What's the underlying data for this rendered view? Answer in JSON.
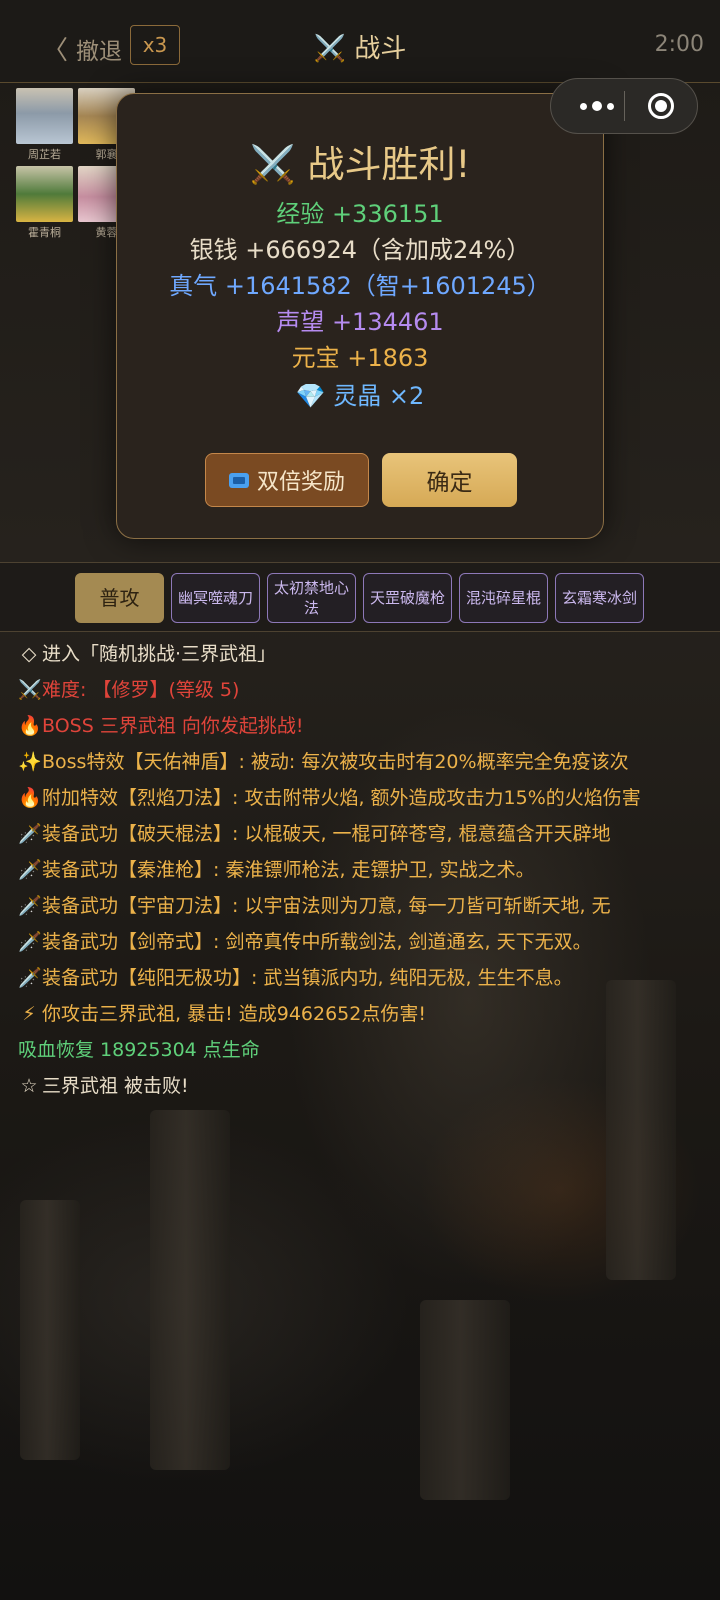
{
  "header": {
    "back_label": "撤退",
    "speed_label": "x3",
    "title_icon": "⚔️",
    "title": "战斗",
    "timer": "2:00"
  },
  "team": [
    {
      "name": "周芷若"
    },
    {
      "name": "郭襄"
    },
    {
      "name": "霍青桐"
    },
    {
      "name": "黄蓉"
    }
  ],
  "modal": {
    "title_icon": "⚔️",
    "title": "战斗胜利!",
    "rewards": [
      {
        "text": "经验 +336151",
        "color": "#5fd07a"
      },
      {
        "text": "银钱 +666924（含加成24%）",
        "color": "#e8ddc8"
      },
      {
        "text": "真气 +1641582（智+1601245）",
        "color": "#6fa8ff"
      },
      {
        "text": "声望 +134461",
        "color": "#b58bf0"
      },
      {
        "text": "元宝 +1863",
        "color": "#ecb24a"
      },
      {
        "text": "灵晶 ×2",
        "color": "#6fb8ff"
      }
    ],
    "gem_icon": "💎",
    "double_button": "双倍奖励",
    "confirm_button": "确定"
  },
  "skills": [
    {
      "label": "普攻"
    },
    {
      "label": "幽冥噬魂刀"
    },
    {
      "label": "太初禁地心法"
    },
    {
      "label": "天罡破魔枪"
    },
    {
      "label": "混沌碎星棍"
    },
    {
      "label": "玄霜寒冰剑"
    }
  ],
  "log": [
    {
      "icon": "◇",
      "text": "进入「随机挑战·三界武祖」",
      "color": "#e8ddc8"
    },
    {
      "icon": "⚔️",
      "text": "难度: 【修罗】(等级 5)",
      "color": "#e0443a"
    },
    {
      "icon": "🔥",
      "text": "BOSS 三界武祖 向你发起挑战!",
      "color": "#e0443a"
    },
    {
      "icon": "✨",
      "text": "Boss特效【天佑神盾】: 被动: 每次被攻击时有20%概率完全免疫该次",
      "color": "#ecb24a"
    },
    {
      "icon": "🔥",
      "text": "附加特效【烈焰刀法】: 攻击附带火焰, 额外造成攻击力15%的火焰伤害",
      "color": "#ecb24a"
    },
    {
      "icon": "🗡️",
      "text": "装备武功【破天棍法】: 以棍破天, 一棍可碎苍穹, 棍意蕴含开天辟地",
      "color": "#ecb24a"
    },
    {
      "icon": "🗡️",
      "text": "装备武功【秦淮枪】: 秦淮镖师枪法, 走镖护卫, 实战之术。",
      "color": "#ecb24a"
    },
    {
      "icon": "🗡️",
      "text": "装备武功【宇宙刀法】: 以宇宙法则为刀意, 每一刀皆可斩断天地, 无",
      "color": "#ecb24a"
    },
    {
      "icon": "🗡️",
      "text": "装备武功【剑帝式】: 剑帝真传中所载剑法, 剑道通玄, 天下无双。",
      "color": "#ecb24a"
    },
    {
      "icon": "🗡️",
      "text": "装备武功【纯阳无极功】: 武当镇派内功, 纯阳无极, 生生不息。",
      "color": "#ecb24a"
    },
    {
      "icon": "⚡",
      "text": "你攻击三界武祖, 暴击! 造成9462652点伤害!",
      "color": "#ecb24a"
    },
    {
      "icon": "",
      "text": "吸血恢复 18925304 点生命",
      "color": "#5fd07a"
    },
    {
      "icon": "☆",
      "text": "三界武祖 被击败!",
      "color": "#e8ddc8"
    }
  ]
}
